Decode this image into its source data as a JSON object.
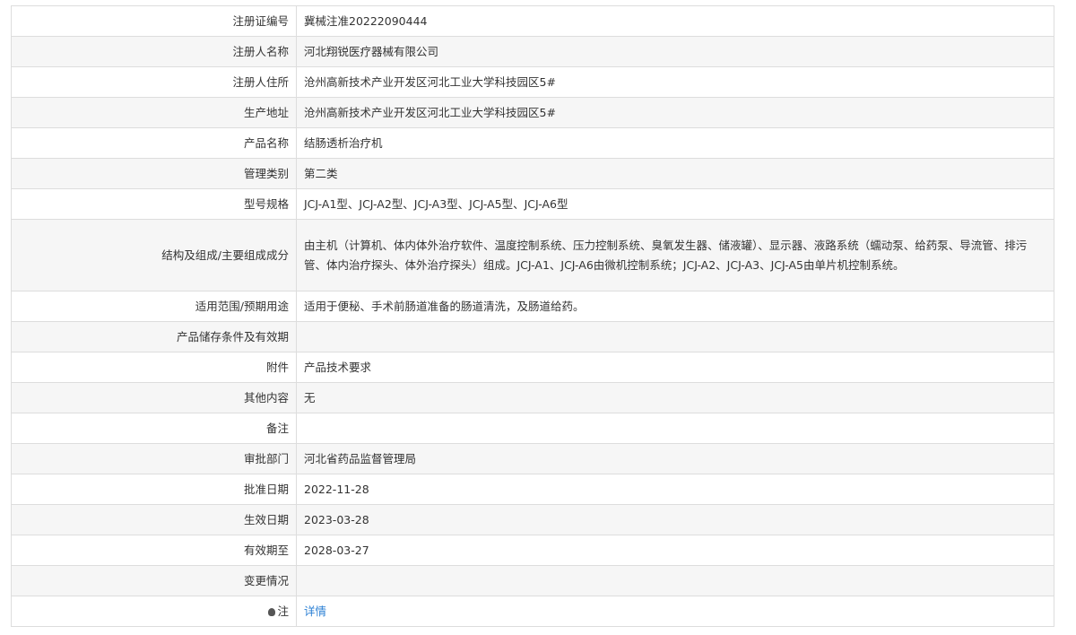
{
  "rows": [
    {
      "label": "注册证编号",
      "value": "冀械注准20222090444"
    },
    {
      "label": "注册人名称",
      "value": "河北翔锐医疗器械有限公司"
    },
    {
      "label": "注册人住所",
      "value": "沧州高新技术产业开发区河北工业大学科技园区5#"
    },
    {
      "label": "生产地址",
      "value": "沧州高新技术产业开发区河北工业大学科技园区5#"
    },
    {
      "label": "产品名称",
      "value": "结肠透析治疗机"
    },
    {
      "label": "管理类别",
      "value": "第二类"
    },
    {
      "label": "型号规格",
      "value": "JCJ-A1型、JCJ-A2型、JCJ-A3型、JCJ-A5型、JCJ-A6型"
    },
    {
      "label": "结构及组成/主要组成成分",
      "value": "由主机（计算机、体内体外治疗软件、温度控制系统、压力控制系统、臭氧发生器、储液罐）、显示器、液路系统（蠕动泵、给药泵、导流管、排污管、体内治疗探头、体外治疗探头）组成。JCJ-A1、JCJ-A6由微机控制系统；JCJ-A2、JCJ-A3、JCJ-A5由单片机控制系统。"
    },
    {
      "label": "适用范围/预期用途",
      "value": "适用于便秘、手术前肠道准备的肠道清洗，及肠道给药。"
    },
    {
      "label": "产品储存条件及有效期",
      "value": ""
    },
    {
      "label": "附件",
      "value": "产品技术要求"
    },
    {
      "label": "其他内容",
      "value": "无"
    },
    {
      "label": "备注",
      "value": ""
    },
    {
      "label": "审批部门",
      "value": "河北省药品监督管理局"
    },
    {
      "label": "批准日期",
      "value": "2022-11-28"
    },
    {
      "label": "生效日期",
      "value": "2023-03-28"
    },
    {
      "label": "有效期至",
      "value": "2028-03-27"
    },
    {
      "label": "变更情况",
      "value": ""
    }
  ],
  "note": {
    "label": "注",
    "icon": "lightbulb-icon",
    "link": "详情",
    "link_color": "#2a7fd4"
  }
}
